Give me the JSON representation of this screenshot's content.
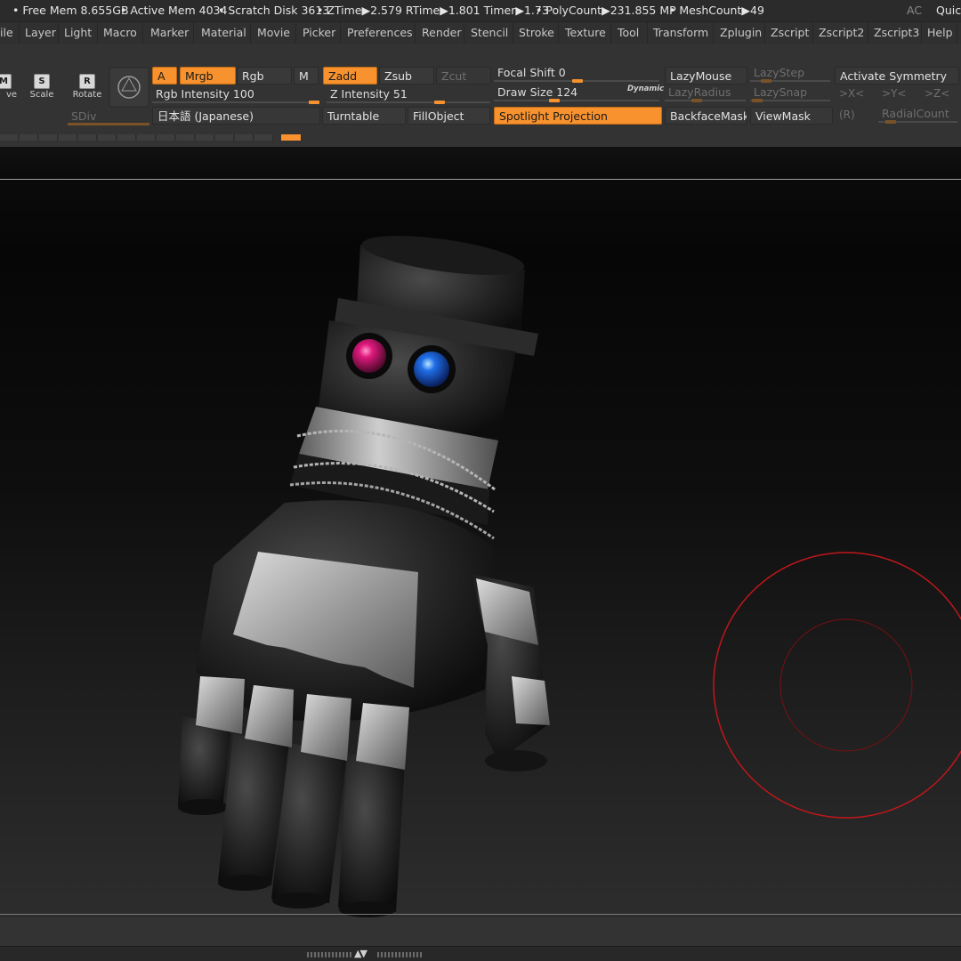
{
  "statusbar": {
    "free_mem": "• Free Mem 8.655GB",
    "active_mem": "• Active Mem 4034",
    "scratch_disk": "• Scratch Disk 3613",
    "timings": "•  ZTime▶2.579 RTime▶1.801 Timer▶1.73",
    "polycount": "• PolyCount▶231.855 MP",
    "meshcount": "• MeshCount▶49",
    "ac": "AC",
    "quick": "Quick"
  },
  "menubar": {
    "items": [
      "ile",
      "Layer",
      "Light",
      "Macro",
      "Marker",
      "Material",
      "Movie",
      "Picker",
      "Preferences",
      "Render",
      "Stencil",
      "Stroke",
      "Texture",
      "Tool",
      "Transform",
      "Zplugin",
      "Zscript",
      "Zscript2",
      "Zscript3",
      "Help"
    ]
  },
  "shelf": {
    "nav": {
      "move_glyph": "M",
      "move_label": "ve",
      "scale_glyph": "S",
      "scale_label": "Scale",
      "rotate_glyph": "R",
      "rotate_label": "Rotate"
    },
    "sdiv_label": "SDiv",
    "a_label": "A",
    "mrgb_label": "Mrgb",
    "rgb_label": "Rgb",
    "m_label": "M",
    "zadd_label": "Zadd",
    "zsub_label": "Zsub",
    "zcut_label": "Zcut",
    "rgb_intensity": {
      "label": "Rgb Intensity 100",
      "value": 100
    },
    "z_intensity": {
      "label": "Z Intensity 51",
      "value": 51
    },
    "language_label": "日本語 (Japanese)",
    "turntable_label": "Turntable",
    "fillobject_label": "FillObject",
    "focal_shift": {
      "label": "Focal Shift 0",
      "value": 0
    },
    "draw_size": {
      "label": "Draw Size 124",
      "value": 124
    },
    "dynamic_label": "Dynamic",
    "spotlight_label": "Spotlight Projection",
    "lazymouse_label": "LazyMouse",
    "lazyradius_label": "LazyRadius",
    "backfacemask_label": "BackfaceMask",
    "lazystep_label": "LazyStep",
    "lazysnap_label": "LazySnap",
    "viewmask_label": "ViewMask",
    "activate_symmetry_label": "Activate Symmetry",
    "x_label": ">X<",
    "y_label": ">Y<",
    "z_label": ">Z<",
    "r_label": "(R)",
    "radialcount_label": "RadialCount"
  },
  "colors": {
    "accent": "#f7922f",
    "brush_cursor": "#c0171b",
    "eye_left": "#e0197d",
    "eye_right": "#1f6ee8"
  },
  "icons": {
    "move": "move-icon",
    "scale": "scale-icon",
    "rotate": "rotate-icon",
    "sphere": "sphere-icon",
    "brush_cursor": "brush-cursor-icon",
    "resize_arrows": "resize-arrows-icon"
  }
}
